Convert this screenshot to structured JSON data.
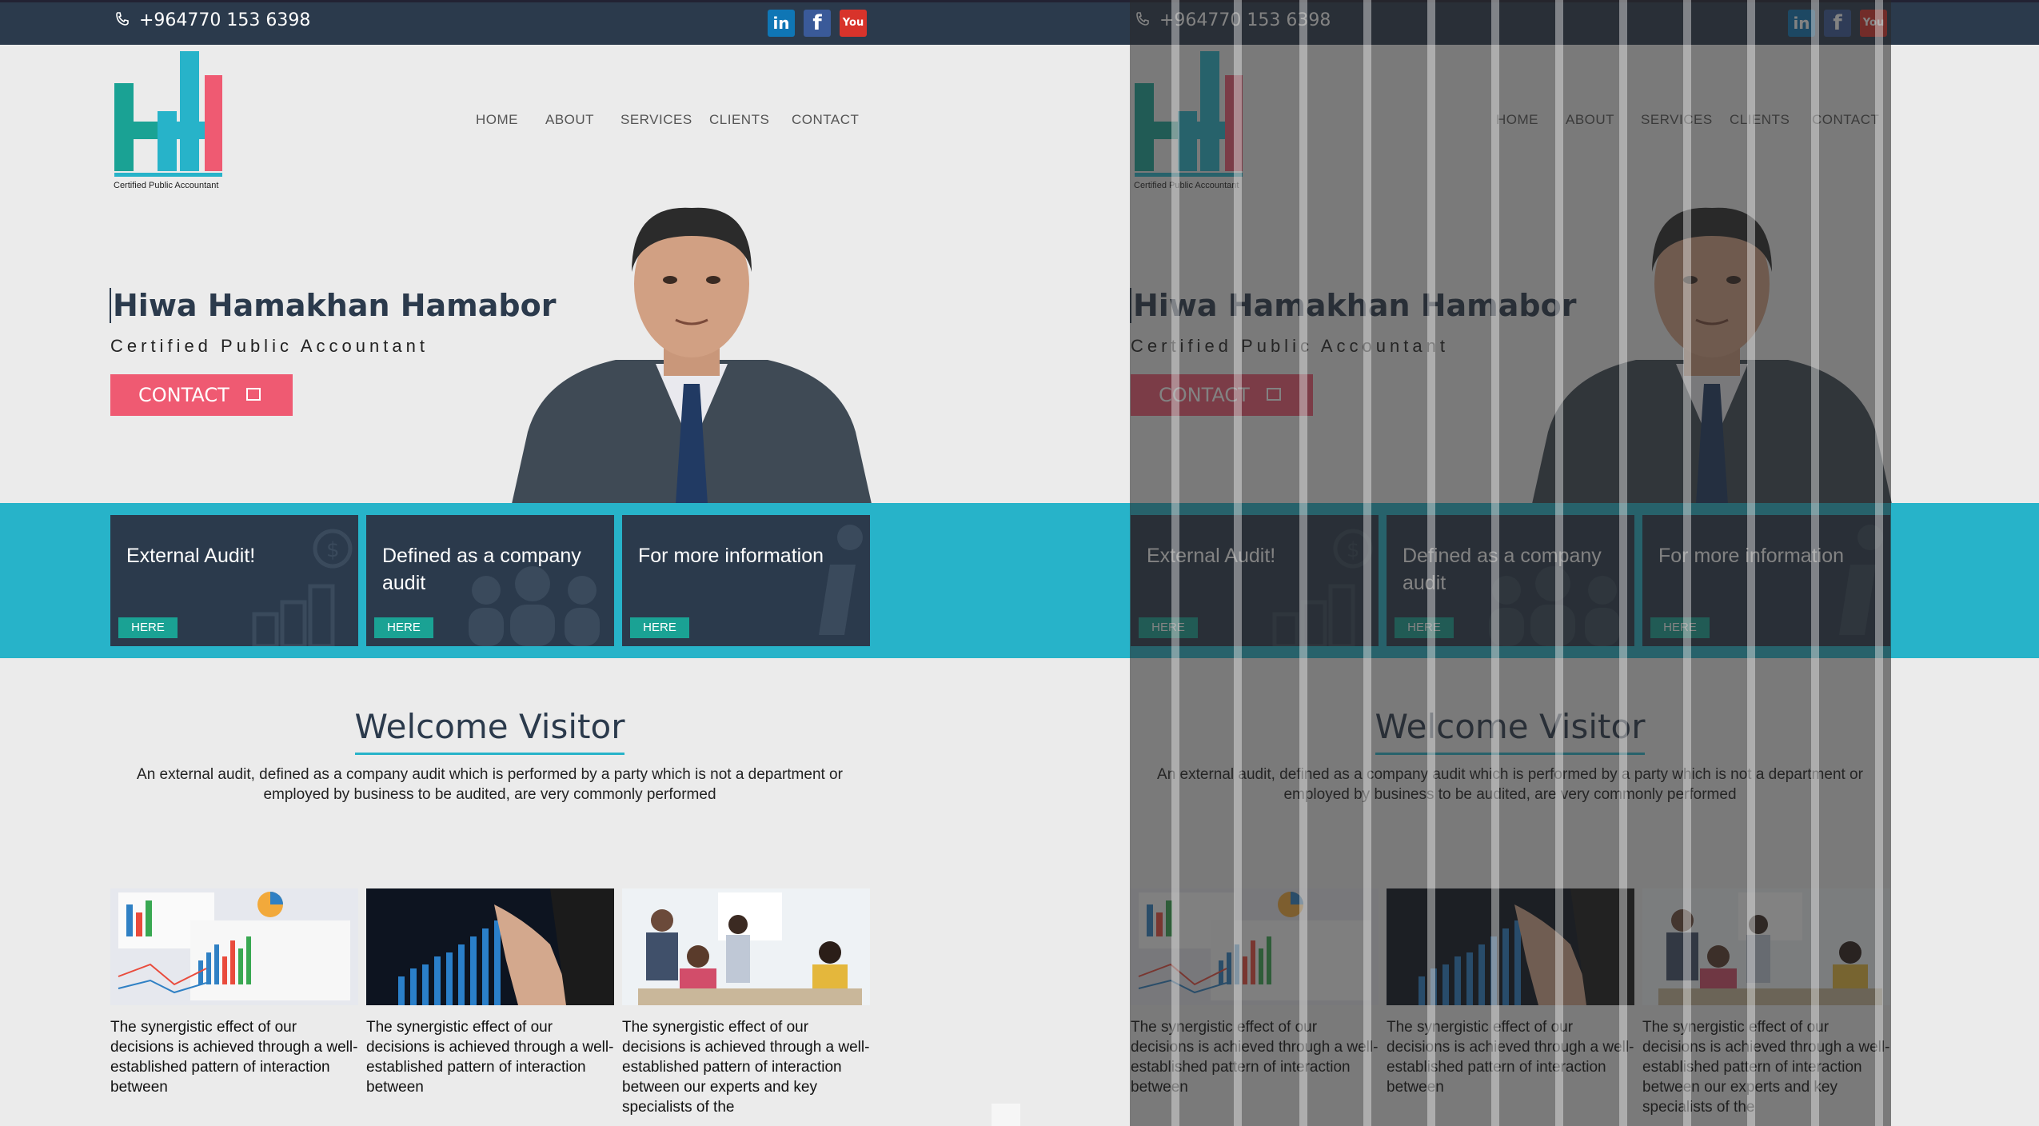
{
  "topbar": {
    "phone": "+964770 153 6398",
    "social": {
      "linkedin_label": "in",
      "facebook_label": "f",
      "youtube_label": "You"
    },
    "phone_icon": "phone-icon"
  },
  "logo": {
    "caption": "Certified Public Accountant",
    "colors": {
      "teal": "#1aa294",
      "cyan": "#27b3c9",
      "pink": "#ef5a72"
    }
  },
  "nav": {
    "items": [
      "HOME",
      "ABOUT",
      "SERVICES",
      "CLIENTS",
      "CONTACT"
    ]
  },
  "hero": {
    "name": "Hiwa Hamakhan Hamabor",
    "subtitle": "Certified Public Accountant",
    "button_label": "CONTACT"
  },
  "cards": [
    {
      "title": "External Audit!",
      "button": "HERE",
      "decor_icon": "bar-chart-icon"
    },
    {
      "title": "Defined as a company audit",
      "button": "HERE",
      "decor_icon": "people-icon"
    },
    {
      "title": "For more information",
      "button": "HERE",
      "decor_icon": "info-icon"
    }
  ],
  "welcome": {
    "heading": "Welcome Visitor",
    "text": "An external audit, defined as a company audit which is performed by a party which is not a department or employed by business to be audited, are very commonly performed"
  },
  "features": [
    {
      "text": "The synergistic effect of our decisions is achieved through a well-established pattern of interaction between"
    },
    {
      "text": "The synergistic effect of our decisions is achieved through a well-established pattern of interaction between"
    },
    {
      "text": "The synergistic effect of our decisions is achieved through a well-established pattern of interaction between our experts and key specialists of the"
    }
  ],
  "theme": {
    "navy": "#2b3a4c",
    "cyan": "#27b3c9",
    "pink": "#ef5a72",
    "teal": "#1aa294",
    "background": "#ebebeb"
  }
}
